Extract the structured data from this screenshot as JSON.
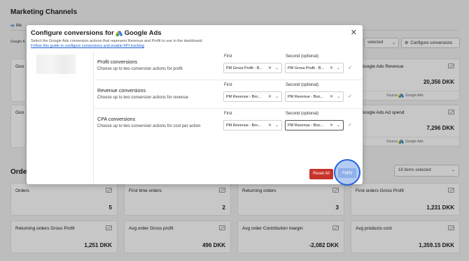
{
  "background": {
    "section_title": "Marketing Channels",
    "tab_meta": "Me",
    "google_cut_label": "Google A",
    "selected_label": "selected",
    "config_button": "Configure conversions",
    "cards_top": [
      {
        "label": "Google Ads Revenue",
        "value": "20,356 DKK",
        "source": "Source",
        "source_name": "Google Ads"
      },
      {
        "label": "Google Ads Ad spend",
        "value": "7,296 DKK",
        "source": "Source",
        "source_name": "Google Ads"
      }
    ],
    "left_card_stub": "Goo",
    "left_card_stub2": "Goo",
    "orders_title": "Order",
    "items_selected": "18 items selected",
    "cards_row1": [
      {
        "label": "Orders",
        "value": "5"
      },
      {
        "label": "First time orders",
        "value": "2"
      },
      {
        "label": "Returning orders",
        "value": "3"
      },
      {
        "label": "First orders Gross Profit",
        "value": "1,231 DKK"
      }
    ],
    "cards_row2": [
      {
        "label": "Returning orders Gross Profit",
        "value": "1,251 DKK"
      },
      {
        "label": "Avg order Gross profit",
        "value": "496 DKK"
      },
      {
        "label": "Avg order Contribution margin",
        "value": "-2,082 DKK"
      },
      {
        "label": "Avg products cost",
        "value": "1,359.15 DKK"
      }
    ]
  },
  "modal": {
    "title_prefix": "Configure conversions for",
    "title_brand": "Google Ads",
    "subtitle": "Select the Google Ads conversion actions that represent Revenue and Profit to use in the dashboard.",
    "guide_link": "Follow this guide to configure conversions and enable KPI tracking",
    "close_glyph": "✕",
    "rows": [
      {
        "title": "Profit conversions",
        "description": "Choose up to two conversion actions for profit",
        "first_label": "First",
        "second_label": "Second (optional)",
        "first_value": "PM Gross Profit - B...",
        "second_value": "PM Gross Profit - B..."
      },
      {
        "title": "Revenue conversions",
        "description": "Choose up to two conversion actions for revenue",
        "first_label": "First",
        "second_label": "Second (optional)",
        "first_value": "PM Revenue - Bro...",
        "second_value": "PM Revenue - Boo..."
      },
      {
        "title": "CPA conversions",
        "description": "Choose up to two conversion actions for cost per action",
        "first_label": "First",
        "second_label": "Second (optional)",
        "first_value": "PM Revenue - Bro...",
        "second_value": "PM Revenue - Boo..."
      }
    ],
    "reset_label": "Reset All",
    "apply_label": "Apply"
  },
  "colors": {
    "reset": "#c7332a",
    "apply": "#8fb0e8",
    "highlight_ring": "#2563d9"
  }
}
